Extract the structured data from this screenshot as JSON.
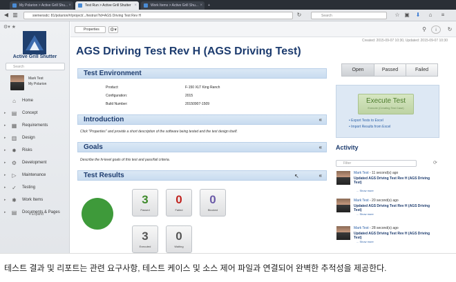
{
  "browser": {
    "tabs": [
      {
        "label": "My Polarion > Active Grill Shu..."
      },
      {
        "label": "Test Run > Active Grill Shutter"
      },
      {
        "label": "Work Items > Active Grill Shu..."
      }
    ],
    "new_tab": "+",
    "url": "siemensdc: 81/polarion/#/project/.../testrun?id=AGS Driving Test Rev H",
    "search_placeholder": "Search"
  },
  "sidebar": {
    "project_name": "Active Grill Shutter",
    "search_placeholder": "Search",
    "user_name": "Mark Test",
    "user_link": "My Polarion",
    "items": [
      {
        "label": "Home",
        "icon": "home-icon",
        "glyph": "⌂"
      },
      {
        "label": "Concept",
        "icon": "concept-icon",
        "glyph": "▤"
      },
      {
        "label": "Requirements",
        "icon": "requirements-icon",
        "glyph": "▦"
      },
      {
        "label": "Design",
        "icon": "design-icon",
        "glyph": "▥"
      },
      {
        "label": "Risks",
        "icon": "risks-icon",
        "glyph": "✸"
      },
      {
        "label": "Development",
        "icon": "development-icon",
        "glyph": "⚙"
      },
      {
        "label": "Maintenance",
        "icon": "maintenance-icon",
        "glyph": "▷"
      },
      {
        "label": "Testing",
        "icon": "testing-icon",
        "glyph": "✓"
      },
      {
        "label": "Work Items",
        "icon": "work-items-icon",
        "glyph": "✱"
      },
      {
        "label": "Documents & Pages",
        "icon": "documents-icon",
        "glyph": "▤"
      }
    ],
    "expand_label": "▾ Expand"
  },
  "toolbar": {
    "properties_label": "Properties",
    "gear_label": "⚙▾"
  },
  "header": {
    "created": "Created: 2015-09-07 10:30, Updated: 2015-09-07 10:30",
    "title": "AGS Driving Test Rev H (AGS Driving Test)"
  },
  "environment": {
    "heading": "Test Environment",
    "rows": [
      {
        "key": "Product:",
        "value": "F-150 XLT King Ranch"
      },
      {
        "key": "Configuration:",
        "value": "2015"
      },
      {
        "key": "Build Number:",
        "value": "20150907-1509"
      }
    ]
  },
  "introduction": {
    "heading": "Introduction",
    "text": "Click \"Properties\" and provide a short description of the software being tested and the test design itself."
  },
  "goals": {
    "heading": "Goals",
    "text": "Describe the hi-level goals of this test and pass/fail criteria."
  },
  "results": {
    "heading": "Test Results",
    "stats": [
      {
        "value": "3",
        "label": "Passed",
        "color": "#3e8a2a"
      },
      {
        "value": "0",
        "label": "Failed",
        "color": "#c0231f"
      },
      {
        "value": "0",
        "label": "Blocked",
        "color": "#6b5aa8"
      },
      {
        "value": "3",
        "label": "Executed",
        "color": "#555555"
      },
      {
        "value": "0",
        "label": "Waiting",
        "color": "#555555"
      }
    ],
    "pie_color": "#3e9a3a"
  },
  "filters": [
    "Open",
    "Passed",
    "Failed"
  ],
  "execute": {
    "title": "Execute Test",
    "subtitle": "Execute (Creating Test Case)",
    "links": [
      "Export Tests to Excel",
      "Import Results from Excel"
    ]
  },
  "activity": {
    "heading": "Activity",
    "filter_placeholder": "Filter",
    "items": [
      {
        "user": "Mark Test",
        "time": " - 11 second(s) ago",
        "text": "Updated AGS Driving Test Rev H (AGS Driving Test)",
        "more": "... Show more"
      },
      {
        "user": "Mark Test",
        "time": " - 20 second(s) ago",
        "text": "Updated AGS Driving Test Rev H (AGS Driving Test)",
        "more": "... Show more"
      },
      {
        "user": "Mark Test",
        "time": " - 28 second(s) ago",
        "text": "Updated AGS Driving Test Rev H (AGS Driving Test)",
        "more": "... Show more"
      }
    ]
  },
  "caption": "테스트 결과 및 리포트는 관련 요구사항, 테스트 케이스 및 소스 제어 파일과 연결되어 완벽한 추적성을 제공한다."
}
